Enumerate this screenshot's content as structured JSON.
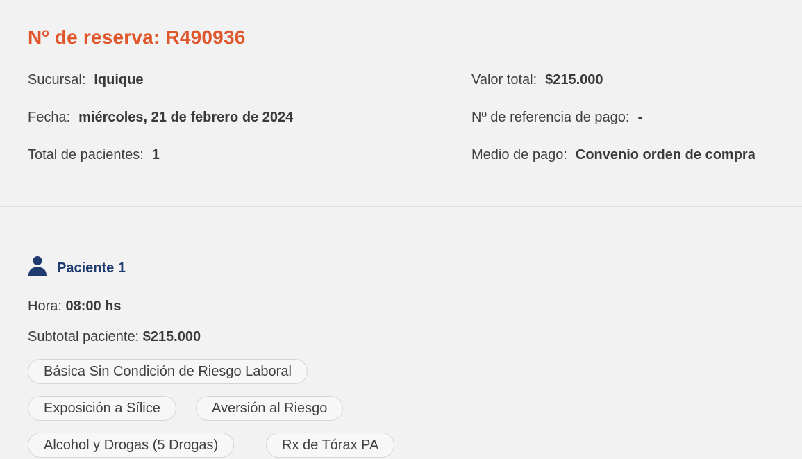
{
  "reservation": {
    "title": "Nº de reserva: R490936"
  },
  "summary": {
    "branch_label": "Sucursal:",
    "branch_value": "Iquique",
    "date_label": "Fecha:",
    "date_value": "miércoles, 21 de febrero de 2024",
    "patients_label": "Total de pacientes:",
    "patients_value": "1",
    "total_label": "Valor total:",
    "total_value": "$215.000",
    "payment_ref_label": "Nº de referencia de pago:",
    "payment_ref_value": "-",
    "payment_method_label": "Medio de pago:",
    "payment_method_value": "Convenio orden de compra"
  },
  "patient": {
    "icon": "person-icon",
    "title": "Paciente 1",
    "time_label": "Hora:",
    "time_value": "08:00 hs",
    "subtotal_label": "Subtotal paciente:",
    "subtotal_value": "$215.000",
    "exams": [
      "Básica Sin Condición de Riesgo Laboral",
      "Exposición a Sílice",
      "Aversión al Riesgo",
      "Alcohol y Drogas (5 Drogas)",
      "Rx de Tórax PA"
    ]
  },
  "colors": {
    "accent": "#e0562b",
    "patient_title": "#1e3a6e",
    "background": "#f2f2f2"
  }
}
